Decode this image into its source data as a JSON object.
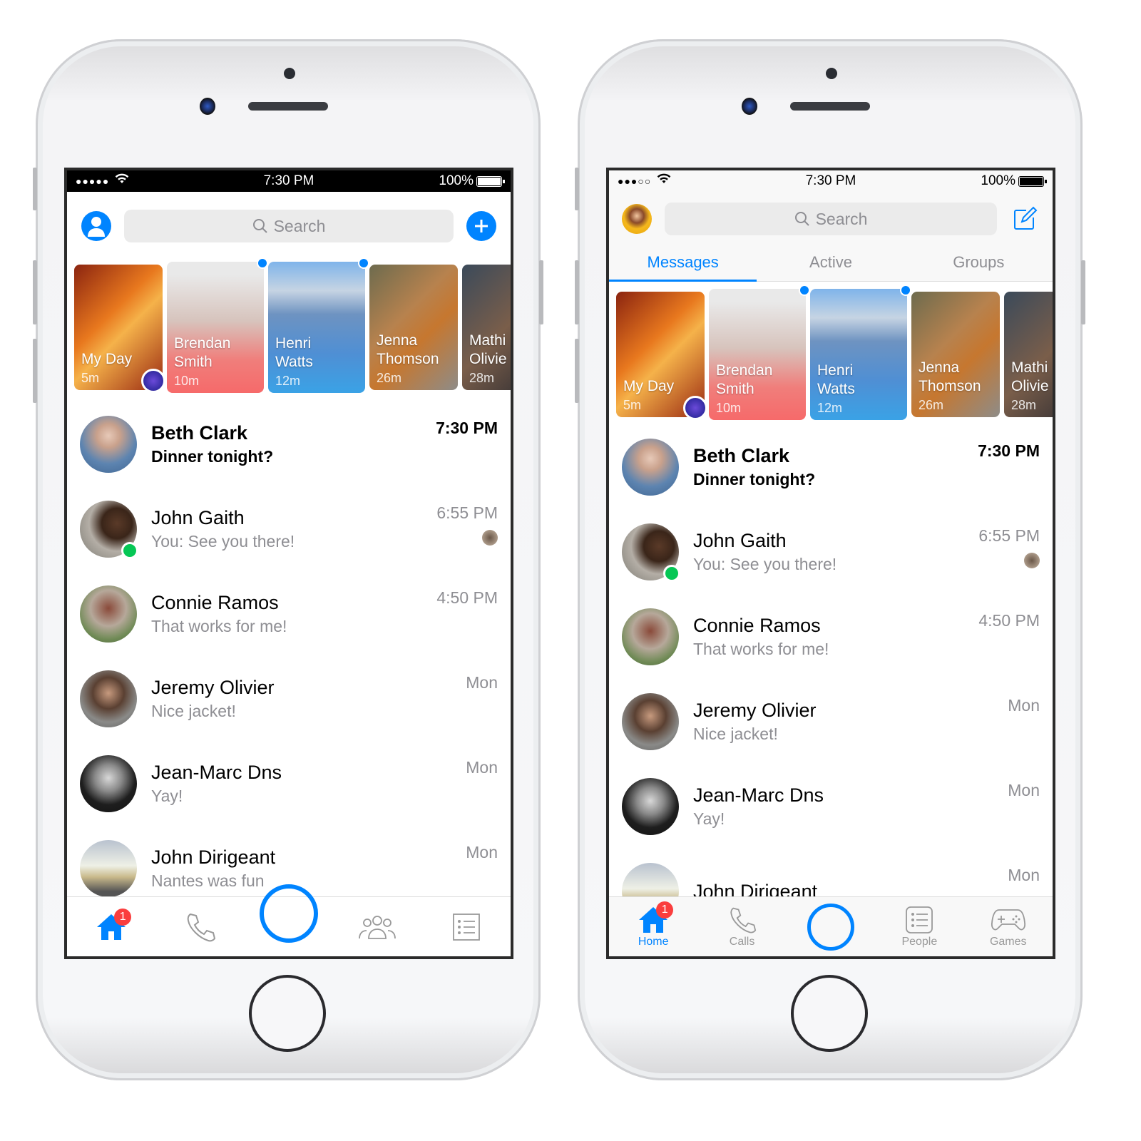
{
  "accent_color": "#0084ff",
  "phones": [
    {
      "status": {
        "time": "7:30 PM",
        "battery": "100%",
        "signal": "●●●●●"
      },
      "search_placeholder": "Search",
      "stories": [
        {
          "name": "My Day",
          "time": "5m"
        },
        {
          "name": "Brendan Smith",
          "time": "10m"
        },
        {
          "name": "Henri Watts",
          "time": "12m"
        },
        {
          "name": "Jenna Thomson",
          "time": "26m"
        },
        {
          "name": "Mathi Olivie",
          "time": "28m"
        }
      ],
      "conversations": [
        {
          "name": "Beth Clark",
          "message": "Dinner tonight?",
          "time": "7:30 PM"
        },
        {
          "name": "John Gaith",
          "message": "You: See you there!",
          "time": "6:55 PM"
        },
        {
          "name": "Connie Ramos",
          "message": "That works for me!",
          "time": "4:50 PM"
        },
        {
          "name": "Jeremy Olivier",
          "message": "Nice jacket!",
          "time": "Mon"
        },
        {
          "name": "Jean-Marc Dns",
          "message": "Yay!",
          "time": "Mon"
        },
        {
          "name": "John Dirigeant",
          "message": "Nantes was fun",
          "time": "Mon"
        }
      ],
      "badge": "1"
    },
    {
      "status": {
        "time": "7:30 PM",
        "battery": "100%",
        "signal": "●●●○○"
      },
      "search_placeholder": "Search",
      "tabs": [
        "Messages",
        "Active",
        "Groups"
      ],
      "stories": [
        {
          "name": "My Day",
          "time": "5m"
        },
        {
          "name": "Brendan Smith",
          "time": "10m"
        },
        {
          "name": "Henri Watts",
          "time": "12m"
        },
        {
          "name": "Jenna Thomson",
          "time": "26m"
        },
        {
          "name": "Mathi Olivie",
          "time": "28m"
        }
      ],
      "conversations": [
        {
          "name": "Beth Clark",
          "message": "Dinner tonight?",
          "time": "7:30 PM"
        },
        {
          "name": "John Gaith",
          "message": "You: See you there!",
          "time": "6:55 PM"
        },
        {
          "name": "Connie Ramos",
          "message": "That works for me!",
          "time": "4:50 PM"
        },
        {
          "name": "Jeremy Olivier",
          "message": "Nice jacket!",
          "time": "Mon"
        },
        {
          "name": "Jean-Marc Dns",
          "message": "Yay!",
          "time": "Mon"
        },
        {
          "name": "John Dirigeant",
          "message": "",
          "time": "Mon"
        }
      ],
      "badge": "1",
      "nav": [
        "Home",
        "Calls",
        "",
        "People",
        "Games"
      ]
    }
  ]
}
